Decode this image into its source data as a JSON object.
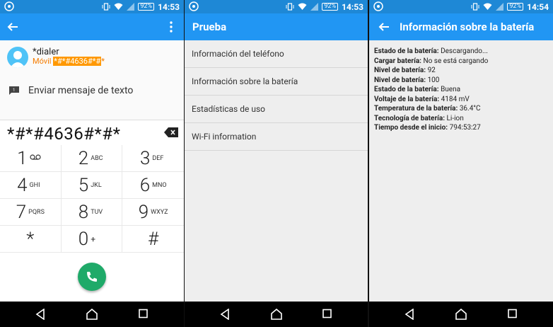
{
  "status": {
    "battery": "92%",
    "times": [
      "14:53",
      "14:53",
      "14:54"
    ]
  },
  "dialer": {
    "contact_name": "*dialer",
    "contact_prefix": "Móvil ",
    "contact_highlight": "*#*#4636#*#",
    "contact_suffix": "*",
    "sms_label": "Enviar mensaje de texto",
    "number": "*#*#4636#*#*",
    "keys": [
      {
        "digit": "1",
        "letters": ""
      },
      {
        "digit": "2",
        "letters": "ABC"
      },
      {
        "digit": "3",
        "letters": "DEF"
      },
      {
        "digit": "4",
        "letters": "GHI"
      },
      {
        "digit": "5",
        "letters": "JKL"
      },
      {
        "digit": "6",
        "letters": "MNO"
      },
      {
        "digit": "7",
        "letters": "PQRS"
      },
      {
        "digit": "8",
        "letters": "TUV"
      },
      {
        "digit": "9",
        "letters": "WXYZ"
      },
      {
        "digit": "*",
        "letters": ""
      },
      {
        "digit": "0",
        "letters": "+"
      },
      {
        "digit": "#",
        "letters": ""
      }
    ]
  },
  "prueba": {
    "title": "Prueba",
    "items": [
      "Información del teléfono",
      "Información sobre la batería",
      "Estadísticas de uso",
      "Wi-Fi information"
    ]
  },
  "battery_info": {
    "title": "Información sobre la batería",
    "rows": [
      {
        "label": "Estado de la batería:",
        "value": "Descargando..."
      },
      {
        "label": "Cargar batería:",
        "value": "No se está cargando"
      },
      {
        "label": "Nivel de batería:",
        "value": "92"
      },
      {
        "label": "Nivel de batería:",
        "value": "100"
      },
      {
        "label": "Estado de la batería:",
        "value": "Buena"
      },
      {
        "label": "Voltaje de la batería:",
        "value": "4184 mV"
      },
      {
        "label": "Temperatura de la batería:",
        "value": "36.4°C"
      },
      {
        "label": "Tecnología de batería:",
        "value": "Li-ion"
      },
      {
        "label": "Tiempo desde el inicio:",
        "value": "794:53:27"
      }
    ]
  }
}
